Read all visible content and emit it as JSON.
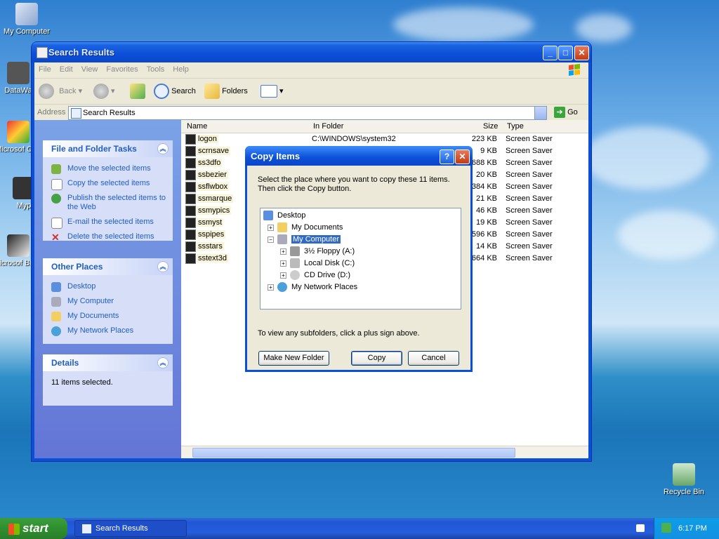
{
  "desktop": {
    "icons": [
      {
        "label": "My Computer"
      },
      {
        "label": "DataWa"
      },
      {
        "label": "Microsof C++"
      },
      {
        "label": "Myp"
      },
      {
        "label": "Microsof Basic"
      },
      {
        "label": "Recycle Bin"
      }
    ]
  },
  "window": {
    "title": "Search Results",
    "menu": [
      "File",
      "Edit",
      "View",
      "Favorites",
      "Tools",
      "Help"
    ],
    "toolbar": {
      "back": "Back",
      "search": "Search",
      "folders": "Folders"
    },
    "address": {
      "label": "Address",
      "value": "Search Results",
      "go": "Go"
    }
  },
  "tasks_panel": {
    "title": "File and Folder Tasks",
    "items": [
      "Move the selected items",
      "Copy the selected items",
      "Publish the selected items to the Web",
      "E-mail the selected items",
      "Delete the selected items"
    ]
  },
  "places_panel": {
    "title": "Other Places",
    "items": [
      "Desktop",
      "My Computer",
      "My Documents",
      "My Network Places"
    ]
  },
  "details_panel": {
    "title": "Details",
    "text": "11 items selected."
  },
  "columns": [
    "Name",
    "In Folder",
    "Size",
    "Type"
  ],
  "files": [
    {
      "name": "logon",
      "folder": "C:\\WINDOWS\\system32",
      "size": "223 KB",
      "type": "Screen Saver"
    },
    {
      "name": "scrnsave",
      "folder": "",
      "size": "9 KB",
      "type": "Screen Saver"
    },
    {
      "name": "ss3dfo",
      "folder": "",
      "size": "688 KB",
      "type": "Screen Saver"
    },
    {
      "name": "ssbezier",
      "folder": "",
      "size": "20 KB",
      "type": "Screen Saver"
    },
    {
      "name": "ssflwbox",
      "folder": "",
      "size": "384 KB",
      "type": "Screen Saver"
    },
    {
      "name": "ssmarque",
      "folder": "",
      "size": "21 KB",
      "type": "Screen Saver"
    },
    {
      "name": "ssmypics",
      "folder": "",
      "size": "46 KB",
      "type": "Screen Saver"
    },
    {
      "name": "ssmyst",
      "folder": "",
      "size": "19 KB",
      "type": "Screen Saver"
    },
    {
      "name": "sspipes",
      "folder": "",
      "size": "596 KB",
      "type": "Screen Saver"
    },
    {
      "name": "ssstars",
      "folder": "",
      "size": "14 KB",
      "type": "Screen Saver"
    },
    {
      "name": "sstext3d",
      "folder": "",
      "size": "664 KB",
      "type": "Screen Saver"
    }
  ],
  "dialog": {
    "title": "Copy Items",
    "instruction": "Select the place where you want to copy these 11 items. Then click the Copy button.",
    "tree": [
      "Desktop",
      "My Documents",
      "My Computer",
      "3½ Floppy (A:)",
      "Local Disk (C:)",
      "CD Drive (D:)",
      "My Network Places"
    ],
    "hint": "To view any subfolders, click a plus sign above.",
    "buttons": {
      "new_folder": "Make New Folder",
      "copy": "Copy",
      "cancel": "Cancel"
    }
  },
  "taskbar": {
    "start": "start",
    "task": "Search Results",
    "clock": "6:17 PM"
  }
}
